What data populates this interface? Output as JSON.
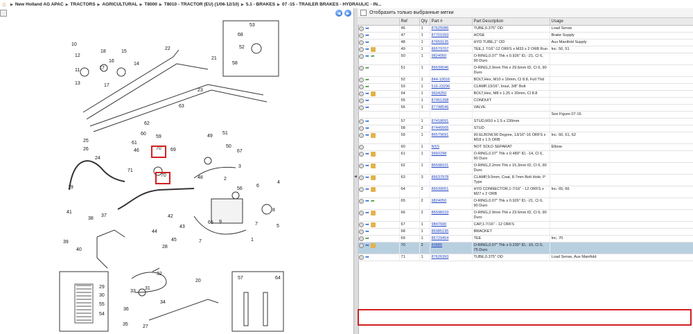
{
  "breadcrumb": {
    "items": [
      "New Holland AG APAC",
      "TRACTORS",
      "AGRICULTURAL",
      "T8000",
      "T8010 - TRACTOR (EU) (1/06-12/10)",
      "5.1 - BRAKES",
      "07 -15 - TRAILER BRAKES - HYDRAULIC - IN..."
    ]
  },
  "filter": {
    "label": "Отобразить только выбранные метки"
  },
  "table": {
    "headers": [
      "",
      "Ref",
      "Qty",
      "Part #",
      "Part Description",
      "Usage"
    ],
    "rows": [
      {
        "ref": "46",
        "qty": "1",
        "part": "87625086",
        "desc": "TUBE,0.375\" OD",
        "usage": "Load Sense",
        "icons": [
          "gear",
          "arrow"
        ]
      },
      {
        "ref": "47",
        "qty": "1",
        "part": "87701093",
        "desc": "HOSE",
        "usage": "Brake Supply",
        "icons": [
          "gear",
          "arrow"
        ]
      },
      {
        "ref": "48",
        "qty": "1",
        "part": "87659135",
        "desc": "HYD TUBE,1\" OD",
        "usage": "Aux Manifold Supply",
        "icons": [
          "gear",
          "arrow"
        ]
      },
      {
        "ref": "49",
        "qty": "1",
        "part": "86579707",
        "desc": "TEE,1 7/16\"-12 ORFS x M33 x 2 ORB Run",
        "usage": "Inc. 50, 51",
        "icons": [
          "gear",
          "arrow",
          "box"
        ]
      },
      {
        "ref": "50",
        "qty": "1",
        "part": "9824050",
        "desc": "O-RING,0.07\" Thk x 0.926\" ID, -21, Cl 6, 90 Duro",
        "usage": "",
        "icons": [
          "gear",
          "arrow",
          "fwd"
        ]
      },
      {
        "ref": "51",
        "qty": "1",
        "part": "86639046",
        "desc": "O-RING,2.9mm Thk x 29.6mm ID, Cl 6, 90 Duro",
        "usage": "",
        "icons": [
          "gear",
          "fwd"
        ]
      },
      {
        "ref": "52",
        "qty": "1",
        "part": "844-10016",
        "desc": "BOLT,Hex, M10 x 16mm, Cl 8.8, Full Thd",
        "usage": "",
        "icons": [
          "gear",
          "fwd"
        ]
      },
      {
        "ref": "53",
        "qty": "1",
        "part": "516-23296",
        "desc": "CLAMP,13/16\", Insul, 3/8\" Bolt",
        "usage": "",
        "icons": [
          "gear",
          "fwd"
        ]
      },
      {
        "ref": "54",
        "qty": "1",
        "part": "9604250",
        "desc": "BOLT,Hex, M8 x 1.25 x 20mm, Cl 8.8",
        "usage": "",
        "icons": [
          "gear",
          "arrow",
          "box"
        ]
      },
      {
        "ref": "55",
        "qty": "1",
        "part": "87451398",
        "desc": "CONDUIT",
        "usage": "",
        "icons": [
          "gear",
          "arrow"
        ]
      },
      {
        "ref": "56",
        "qty": "1",
        "part": "87748546",
        "desc": "VALVE",
        "usage": "",
        "icons": [
          "gear",
          "arrow"
        ]
      },
      {
        "ref": "",
        "qty": "",
        "part": "",
        "desc": "",
        "usage": "See Figure 07-16",
        "icons": []
      },
      {
        "ref": "57",
        "qty": "1",
        "part": "87418091",
        "desc": "STUD,M10 x 1.5 x 230mm",
        "usage": "",
        "icons": [
          "gear",
          "arrow"
        ]
      },
      {
        "ref": "58",
        "qty": "2",
        "part": "87445565",
        "desc": "STUD",
        "usage": "",
        "icons": [
          "gear",
          "arrow"
        ]
      },
      {
        "ref": "59",
        "qty": "1",
        "part": "86579691",
        "desc": "90 ELBOW,90 Degree, 13/16\"-16 ORFS x M18 x 1.5 ORB",
        "usage": "Inc. 60, 61, 62",
        "icons": [
          "gear",
          "arrow",
          "box"
        ]
      },
      {
        "ref": "60",
        "qty": "1",
        "part": "NSS",
        "desc": "NOT SOLD SEPARAT",
        "usage": "Elbow",
        "icons": [
          "gear"
        ]
      },
      {
        "ref": "61",
        "qty": "1",
        "part": "9992298",
        "desc": "O-RING,0.07\" Thk x 0.489\" ID, -14, Cl 6, 90 Duro",
        "usage": "",
        "icons": [
          "gear",
          "arrow",
          "box"
        ]
      },
      {
        "ref": "62",
        "qty": "1",
        "part": "86598101",
        "desc": "O-RING,2.2mm Thk x 15.3mm ID, Cl 6, 90 Duro",
        "usage": "",
        "icons": [
          "gear",
          "arrow",
          "box"
        ]
      },
      {
        "ref": "63",
        "qty": "3",
        "part": "86637978",
        "desc": "CLAMP,9.5mm, Coat, 8.7mm Bolt Hole, P Type",
        "usage": "",
        "icons": [
          "gear",
          "arrow",
          "box"
        ]
      },
      {
        "ref": "64",
        "qty": "2",
        "part": "86639051",
        "desc": "HYD CONNECTOR,1-7/16\" - 12 ORFS x M27 x 2 ORB",
        "usage": "Inc. 65, 66",
        "icons": [
          "gear",
          "arrow",
          "box"
        ]
      },
      {
        "ref": "65",
        "qty": "2",
        "part": "9824050",
        "desc": "O-RING,0.07\" Thk x 0.926\" ID, -21, Cl 6, 90 Duro",
        "usage": "",
        "icons": [
          "gear",
          "arrow",
          "fwd"
        ]
      },
      {
        "ref": "66",
        "qty": "2",
        "part": "86598103",
        "desc": "O-RING,2.9mm Thk x 23.6mm ID, Cl 6, 90 Duro",
        "usage": "",
        "icons": [
          "gear",
          "arrow",
          "box"
        ]
      },
      {
        "ref": "67",
        "qty": "1",
        "part": "9847690",
        "desc": "CAP,1-7/16\" - 12 ORFS",
        "usage": "",
        "icons": [
          "gear",
          "arrow",
          "box"
        ]
      },
      {
        "ref": "68",
        "qty": "1",
        "part": "86985195",
        "desc": "BRACKET",
        "usage": "",
        "icons": [
          "gear",
          "arrow"
        ]
      },
      {
        "ref": "69",
        "qty": "1",
        "part": "86729454",
        "desc": "TEE",
        "usage": "Inc. 70",
        "icons": [
          "gear",
          "fwd"
        ]
      },
      {
        "ref": "70",
        "qty": "2",
        "part": "49886",
        "desc": "O-RING,0.07\" Thk x 0.239\" ID, -10, Cl 5, 75 Duro",
        "usage": "",
        "icons": [
          "gear",
          "arrow",
          "box"
        ],
        "selected": true
      },
      {
        "ref": "71",
        "qty": "1",
        "part": "87626393",
        "desc": "TUBE,0.375\" OD",
        "usage": "Load Sense, Aux Manifold",
        "icons": [
          "gear",
          "arrow"
        ]
      }
    ]
  },
  "diagram": {
    "callouts": [
      "10",
      "12",
      "18",
      "15",
      "16",
      "17",
      "11",
      "13",
      "17",
      "14",
      "22",
      "21",
      "23",
      "63",
      "62",
      "60",
      "61",
      "59",
      "46",
      "70",
      "69",
      "49",
      "51",
      "50",
      "67",
      "25",
      "26",
      "24",
      "19",
      "71",
      "70",
      "48",
      "3",
      "2",
      "56",
      "6",
      "4",
      "8",
      "7",
      "5",
      "41",
      "38",
      "37",
      "39",
      "40",
      "42",
      "44",
      "43",
      "45",
      "28",
      "32",
      "31",
      "33",
      "34",
      "35",
      "36",
      "27",
      "20",
      "29",
      "30",
      "55",
      "54",
      "53",
      "68",
      "52",
      "58",
      "57",
      "64",
      "66",
      "9",
      "1",
      "7"
    ]
  }
}
